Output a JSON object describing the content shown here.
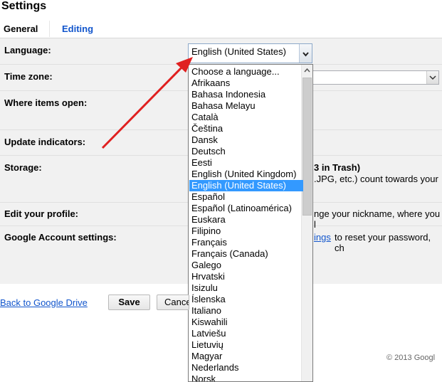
{
  "page": {
    "title": "Settings"
  },
  "tabs": {
    "general": "General",
    "editing": "Editing"
  },
  "settings": {
    "language_label": "Language:",
    "language_value": "English (United States)",
    "timezone_label": "Time zone:",
    "items_open_label": "Where items open:",
    "update_label": "Update indicators:",
    "storage_label": "Storage:",
    "storage_text1": "3 in Trash)",
    "storage_text2": ".JPG, etc.) count towards your",
    "profile_label": "Edit your profile:",
    "profile_text": "nge your nickname, where you l",
    "google_account_label": "Google Account settings:",
    "google_account_link": "ings",
    "google_account_text": "to reset your password, ch"
  },
  "language_options": [
    "Choose a language...",
    "Afrikaans",
    "Bahasa Indonesia",
    "Bahasa Melayu",
    "Català",
    "Čeština",
    "Dansk",
    "Deutsch",
    "Eesti",
    "English (United Kingdom)",
    "English (United States)",
    "Español",
    "Español (Latinoamérica)",
    "Euskara",
    "Filipino",
    "Français",
    "Français (Canada)",
    "Galego",
    "Hrvatski",
    "Isizulu",
    "Íslenska",
    "Italiano",
    "Kiswahili",
    "Latviešu",
    "Lietuvių",
    "Magyar",
    "Nederlands",
    "Norsk"
  ],
  "selected_index": 10,
  "footer": {
    "back_link": "Back to Google Drive",
    "save": "Save",
    "cancel": "Cance",
    "copyright": "© 2013 Googl"
  },
  "icons": {
    "dropdown": "chevron-down-icon",
    "annotation": "red-arrow"
  },
  "colors": {
    "link": "#1155cc",
    "selection": "#3399ff",
    "arrow": "#e02020"
  }
}
